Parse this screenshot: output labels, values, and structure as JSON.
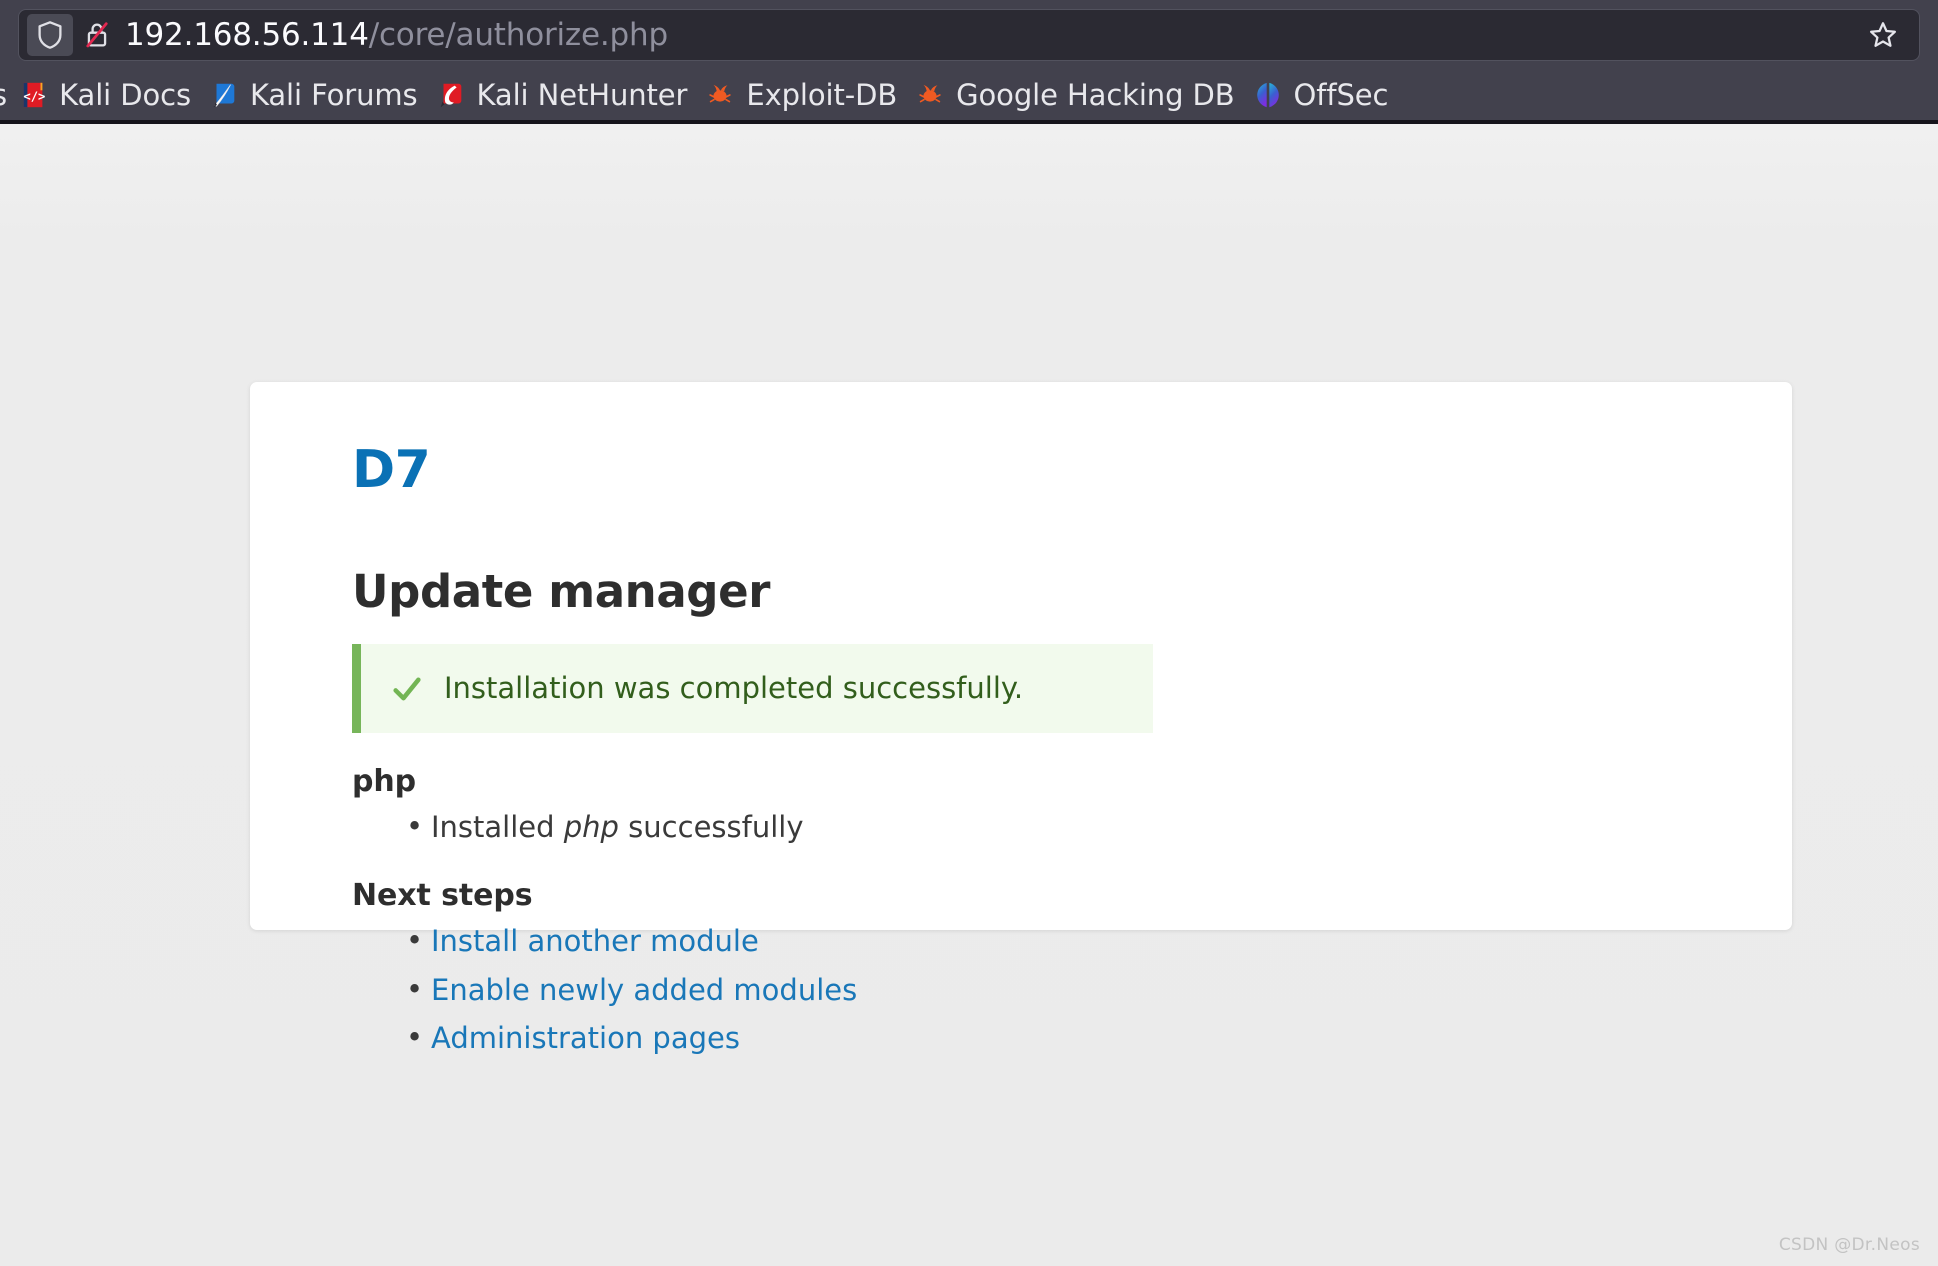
{
  "browser": {
    "url_host": "192.168.56.114",
    "url_path": "/core/authorize.php",
    "shield_icon": "shield-icon",
    "insecure_icon": "lock-slash-icon",
    "bookmark_star_icon": "star-outline-icon",
    "clipped_bookmark_label": "s",
    "bookmarks": [
      {
        "label": "Kali Docs",
        "icon": "kali-docs-icon"
      },
      {
        "label": "Kali Forums",
        "icon": "kali-forums-icon"
      },
      {
        "label": "Kali NetHunter",
        "icon": "kali-nethunter-icon"
      },
      {
        "label": "Exploit-DB",
        "icon": "exploit-db-icon"
      },
      {
        "label": "Google Hacking DB",
        "icon": "google-hacking-db-icon"
      },
      {
        "label": "OffSec",
        "icon": "offsec-icon"
      }
    ]
  },
  "colors": {
    "logo_blue": "#0a71b5",
    "link_blue": "#1977b8",
    "success_bg": "#f2faed",
    "success_border": "#77b55a",
    "success_text": "#325e1c",
    "chrome_bg": "#42414d",
    "urlbar_bg": "#2b2a33",
    "page_bg": "#ebebeb"
  },
  "main": {
    "site_logo": "D7",
    "page_title": "Update manager",
    "status": {
      "icon": "check-icon",
      "message": "Installation was completed successfully."
    },
    "module_section": {
      "heading": "php",
      "items": [
        {
          "prefix": "Installed ",
          "emphasis": "php",
          "suffix": " successfully"
        }
      ]
    },
    "next_steps": {
      "heading": "Next steps",
      "links": [
        "Install another module",
        "Enable newly added modules",
        "Administration pages"
      ]
    }
  },
  "watermark": "CSDN @Dr.Neos"
}
